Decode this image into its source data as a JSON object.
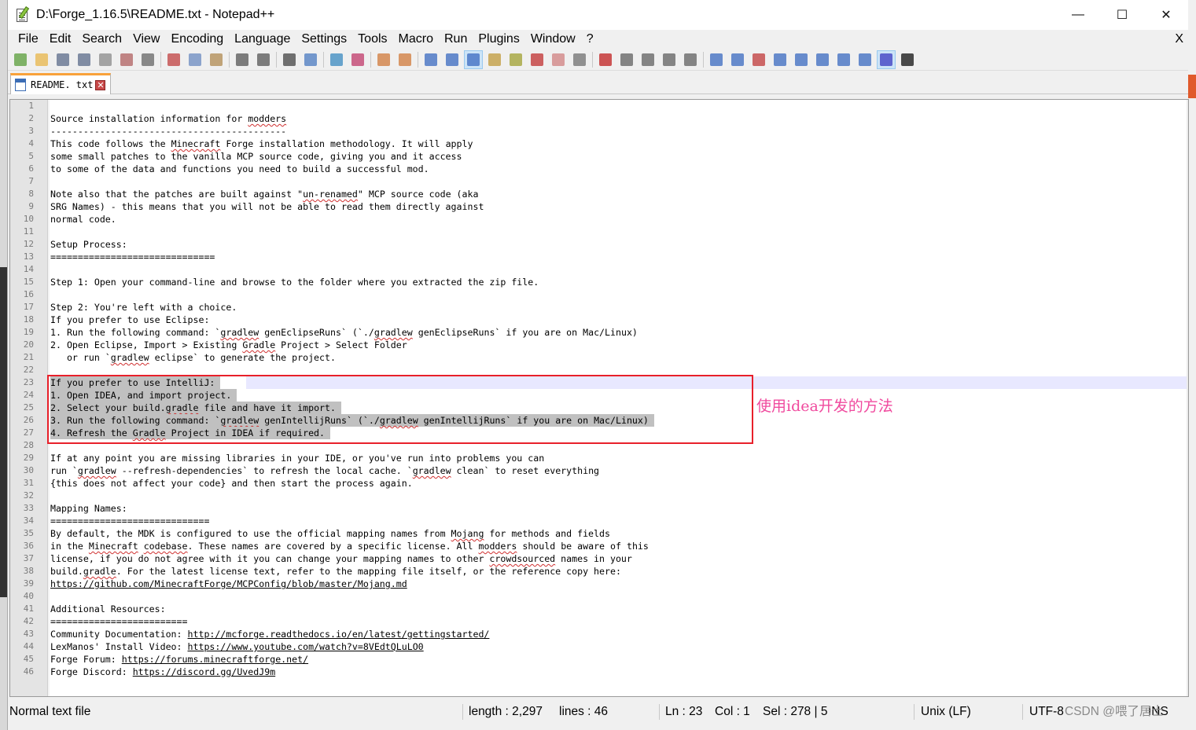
{
  "window": {
    "title": "D:\\Forge_1.16.5\\README.txt - Notepad++",
    "minimize": "—",
    "maximize": "☐",
    "close": "✕"
  },
  "menu": [
    "File",
    "Edit",
    "Search",
    "View",
    "Encoding",
    "Language",
    "Settings",
    "Tools",
    "Macro",
    "Run",
    "Plugins",
    "Window",
    "?"
  ],
  "menu_close": "X",
  "tab": {
    "label": "README. txt",
    "close": "✕"
  },
  "editor": {
    "lines": [
      "",
      "Source installation information for modders",
      "-------------------------------------------",
      "This code follows the Minecraft Forge installation methodology. It will apply",
      "some small patches to the vanilla MCP source code, giving you and it access",
      "to some of the data and functions you need to build a successful mod.",
      "",
      "Note also that the patches are built against \"un-renamed\" MCP source code (aka",
      "SRG Names) - this means that you will not be able to read them directly against",
      "normal code.",
      "",
      "Setup Process:",
      "==============================",
      "",
      "Step 1: Open your command-line and browse to the folder where you extracted the zip file.",
      "",
      "Step 2: You're left with a choice.",
      "If you prefer to use Eclipse:",
      "1. Run the following command: `gradlew genEclipseRuns` (`./gradlew genEclipseRuns` if you are on Mac/Linux)",
      "2. Open Eclipse, Import > Existing Gradle Project > Select Folder",
      "   or run `gradlew eclipse` to generate the project.",
      "",
      "If you prefer to use IntelliJ:",
      "1. Open IDEA, and import project.",
      "2. Select your build.gradle file and have it import.",
      "3. Run the following command: `gradlew genIntellijRuns` (`./gradlew genIntellijRuns` if you are on Mac/Linux)",
      "4. Refresh the Gradle Project in IDEA if required.",
      "",
      "If at any point you are missing libraries in your IDE, or you've run into problems you can",
      "run `gradlew --refresh-dependencies` to refresh the local cache. `gradlew clean` to reset everything",
      "{this does not affect your code} and then start the process again.",
      "",
      "Mapping Names:",
      "=============================",
      "By default, the MDK is configured to use the official mapping names from Mojang for methods and fields",
      "in the Minecraft codebase. These names are covered by a specific license. All modders should be aware of this",
      "license, if you do not agree with it you can change your mapping names to other crowdsourced names in your",
      "build.gradle. For the latest license text, refer to the mapping file itself, or the reference copy here:",
      "https://github.com/MinecraftForge/MCPConfig/blob/master/Mojang.md",
      "",
      "Additional Resources:",
      "=========================",
      "Community Documentation: http://mcforge.readthedocs.io/en/latest/gettingstarted/",
      "LexManos' Install Video: https://www.youtube.com/watch?v=8VEdtQLuLO0",
      "Forge Forum: https://forums.minecraftforge.net/",
      "Forge Discord: https://discord.gg/UvedJ9m"
    ],
    "selected_lines": [
      23,
      24,
      25,
      26,
      27
    ],
    "current_line": 23,
    "annotation": "使用idea开发的方法"
  },
  "status": {
    "file_type": "Normal text file",
    "length": "length : 2,297",
    "lines": "lines : 46",
    "ln": "Ln : 23",
    "col": "Col : 1",
    "sel": "Sel : 278 | 5",
    "eol": "Unix (LF)",
    "encoding": "UTF-8",
    "mode": "INS",
    "watermark": "CSDN @喂了居士"
  }
}
